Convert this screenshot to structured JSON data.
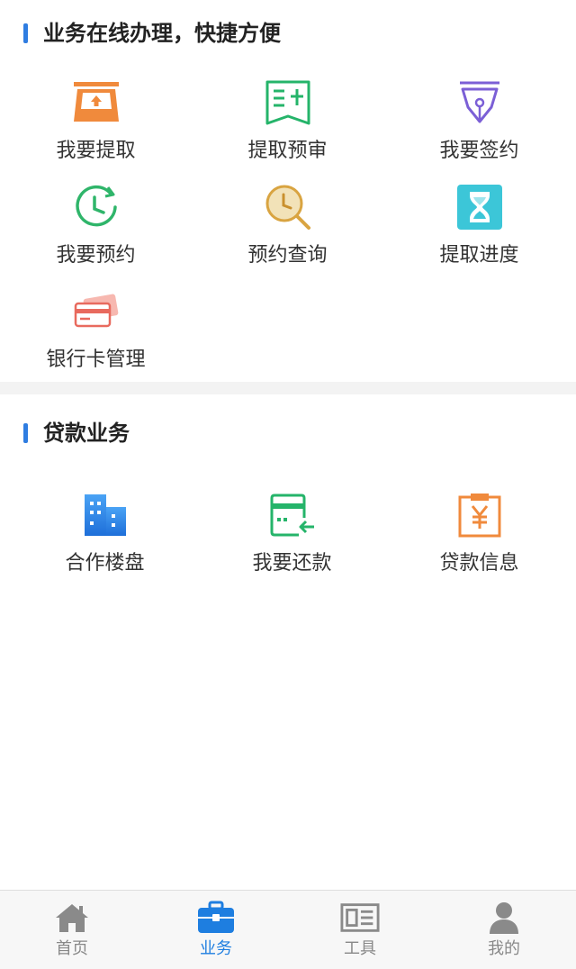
{
  "section1": {
    "title": "业务在线办理，快捷方便",
    "items": [
      {
        "label": "我要提取",
        "icon": "withdraw-tray-icon",
        "color": "#f08a3c"
      },
      {
        "label": "提取预审",
        "icon": "document-plus-icon",
        "color": "#25b46a"
      },
      {
        "label": "我要签约",
        "icon": "pen-nib-icon",
        "color": "#7b5fd6"
      },
      {
        "label": "我要预约",
        "icon": "clock-icon",
        "color": "#2fb56a"
      },
      {
        "label": "预约查询",
        "icon": "clock-search-icon",
        "color": "#d9a441"
      },
      {
        "label": "提取进度",
        "icon": "hourglass-icon",
        "color": "#3cc6d8"
      },
      {
        "label": "银行卡管理",
        "icon": "bank-cards-icon",
        "color": "#e86a5e"
      }
    ]
  },
  "section2": {
    "title": "贷款业务",
    "items": [
      {
        "label": "合作楼盘",
        "icon": "building-icon",
        "color": "#2f8ae8"
      },
      {
        "label": "我要还款",
        "icon": "card-repay-icon",
        "color": "#25b46a"
      },
      {
        "label": "贷款信息",
        "icon": "yuan-clipboard-icon",
        "color": "#f08a3c"
      }
    ]
  },
  "tabbar": {
    "tabs": [
      {
        "label": "首页",
        "icon": "home-icon",
        "active": false
      },
      {
        "label": "业务",
        "icon": "briefcase-icon",
        "active": true
      },
      {
        "label": "工具",
        "icon": "newspaper-icon",
        "active": false
      },
      {
        "label": "我的",
        "icon": "person-icon",
        "active": false
      }
    ],
    "active_color": "#1e7ee0",
    "inactive_color": "#888888"
  },
  "accent_color": "#2f7de1"
}
